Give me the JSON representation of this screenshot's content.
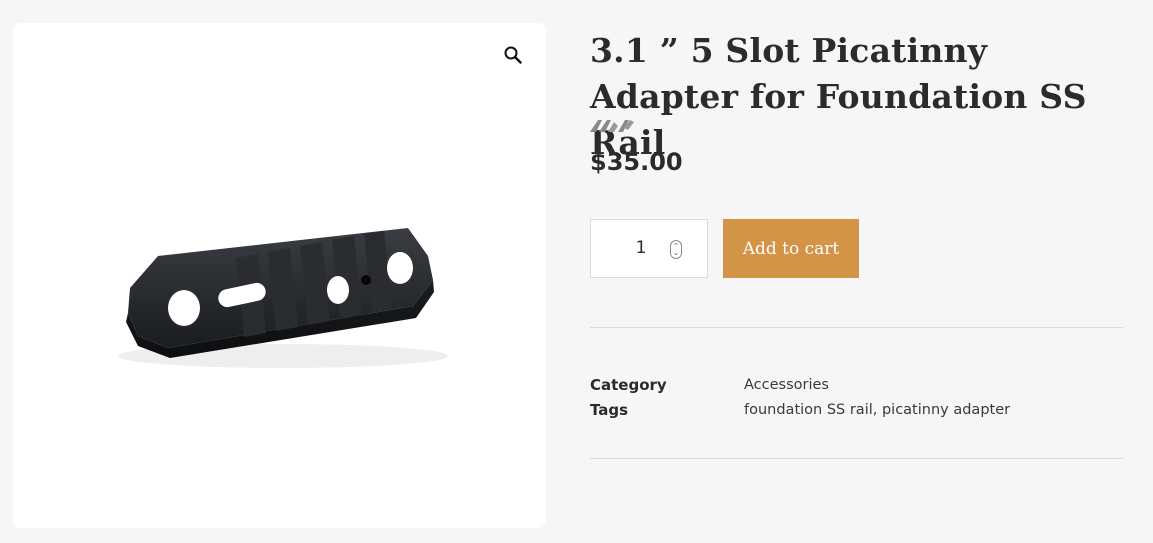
{
  "gallery": {
    "zoom_icon": "magnifier-icon",
    "image_alt": "3.1 inch 5 slot picatinny rail adapter, black anodized"
  },
  "product": {
    "title": "3.1 ” 5 Slot Picatinny Adapter for Foundation SS Rail",
    "brand_icon": "brand-logo-icon",
    "price": "$35.00"
  },
  "cart": {
    "quantity": "1",
    "spinner_icon": "stepper-icon",
    "add_to_cart_label": "Add to cart"
  },
  "meta": {
    "category_label": "Category",
    "category_value": "Accessories",
    "tags_label": "Tags",
    "tags_value": "foundation SS rail, picatinny adapter"
  },
  "colors": {
    "background": "#f6f6f6",
    "accent_button": "#d39447",
    "text": "#2b2b2b",
    "divider": "#dcdcdc"
  }
}
